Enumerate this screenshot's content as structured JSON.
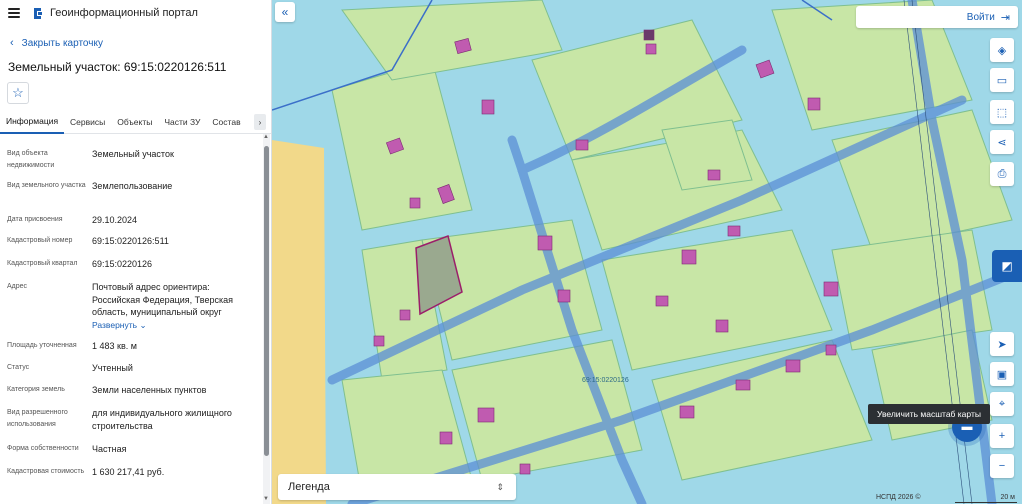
{
  "app": {
    "title": "Геоинформационный портал"
  },
  "card": {
    "back_label": "Закрыть карточку",
    "title": "Земельный участок: 69:15:0220126:511"
  },
  "tabs": [
    {
      "label": "Информация",
      "active": true
    },
    {
      "label": "Сервисы"
    },
    {
      "label": "Объекты"
    },
    {
      "label": "Части ЗУ"
    },
    {
      "label": "Состав"
    }
  ],
  "info": {
    "rows": [
      {
        "label": "Вид объекта недвижимости",
        "value": "Земельный участок"
      },
      {
        "label": "Вид земельного участка",
        "value": "Землепользование"
      },
      {
        "label": "Дата присвоения",
        "value": "29.10.2024"
      },
      {
        "label": "Кадастровый номер",
        "value": "69:15:0220126:511"
      },
      {
        "label": "Кадастровый квартал",
        "value": "69:15:0220126"
      },
      {
        "label": "Адрес",
        "value": "Почтовый адрес ориентира: Российская Федерация, Тверская область, муниципальный округ"
      },
      {
        "label": "Площадь уточненная",
        "value": "1 483 кв. м"
      },
      {
        "label": "Статус",
        "value": "Учтенный"
      },
      {
        "label": "Категория земель",
        "value": "Земли населенных пунктов"
      },
      {
        "label": "Вид разрешенного использования",
        "value": "для индивидуального жилищного строительства"
      },
      {
        "label": "Форма собственности",
        "value": "Частная"
      },
      {
        "label": "Кадастровая стоимость",
        "value": "1 630 217,41 руб."
      }
    ],
    "expand_label": "Развернуть"
  },
  "map": {
    "login_label": "Войти",
    "legend_label": "Легенда",
    "tooltip": "Увеличить масштаб карты",
    "credit": "НСПД 2026 ©",
    "scale": "20 м",
    "parcel_label": "69:15:0220126"
  },
  "colors": {
    "accent": "#1a5fb4",
    "map_water": "#9fd8e8",
    "parcel_green": "#c8e6a6",
    "building": "#c05bb0",
    "road": "#5b8fd6"
  }
}
